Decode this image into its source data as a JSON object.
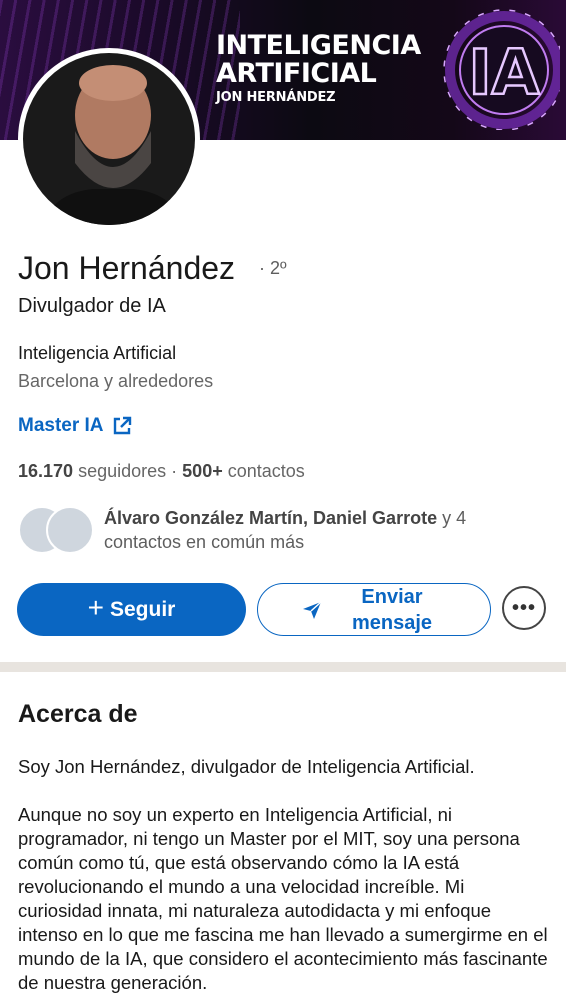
{
  "banner": {
    "title": "Inteligencia Artificial",
    "subtitle": "Jon Hernández",
    "badge_text": "IA"
  },
  "profile": {
    "name": "Jon Hernández",
    "degree": "· 2º",
    "headline": "Divulgador de IA",
    "company": "Inteligencia Artificial",
    "location": "Barcelona y alrededores",
    "website_label": "Master IA",
    "followers": "16.170",
    "followers_label": "seguidores",
    "separator": "·",
    "connections": "500+",
    "connections_label": "contactos"
  },
  "mutual": {
    "names": "Álvaro González Martín, Daniel Garrote",
    "rest": "y 4 contactos en común más"
  },
  "actions": {
    "follow_label": "Seguir",
    "message_label": "Enviar mensaje",
    "more_label": "•••"
  },
  "about": {
    "title": "Acerca de",
    "p1": "Soy Jon Hernández, divulgador de Inteligencia Artificial.",
    "p2": "Aunque no soy un experto en Inteligencia Artificial, ni programador, ni tengo un Master por el MIT, soy una persona común como tú, que está observando cómo la IA está revolucionando el mundo a una velocidad increíble. Mi curiosidad innata, mi naturaleza autodidacta y mi enfoque intenso en lo que me fascina me han llevado a sumergirme en el mundo de la IA, que considero el acontecimiento más fascinante de nuestra generación."
  },
  "colors": {
    "accent": "#0a66c2",
    "banner_dark": "#0c0a12",
    "banner_purple": "#a855f7"
  }
}
